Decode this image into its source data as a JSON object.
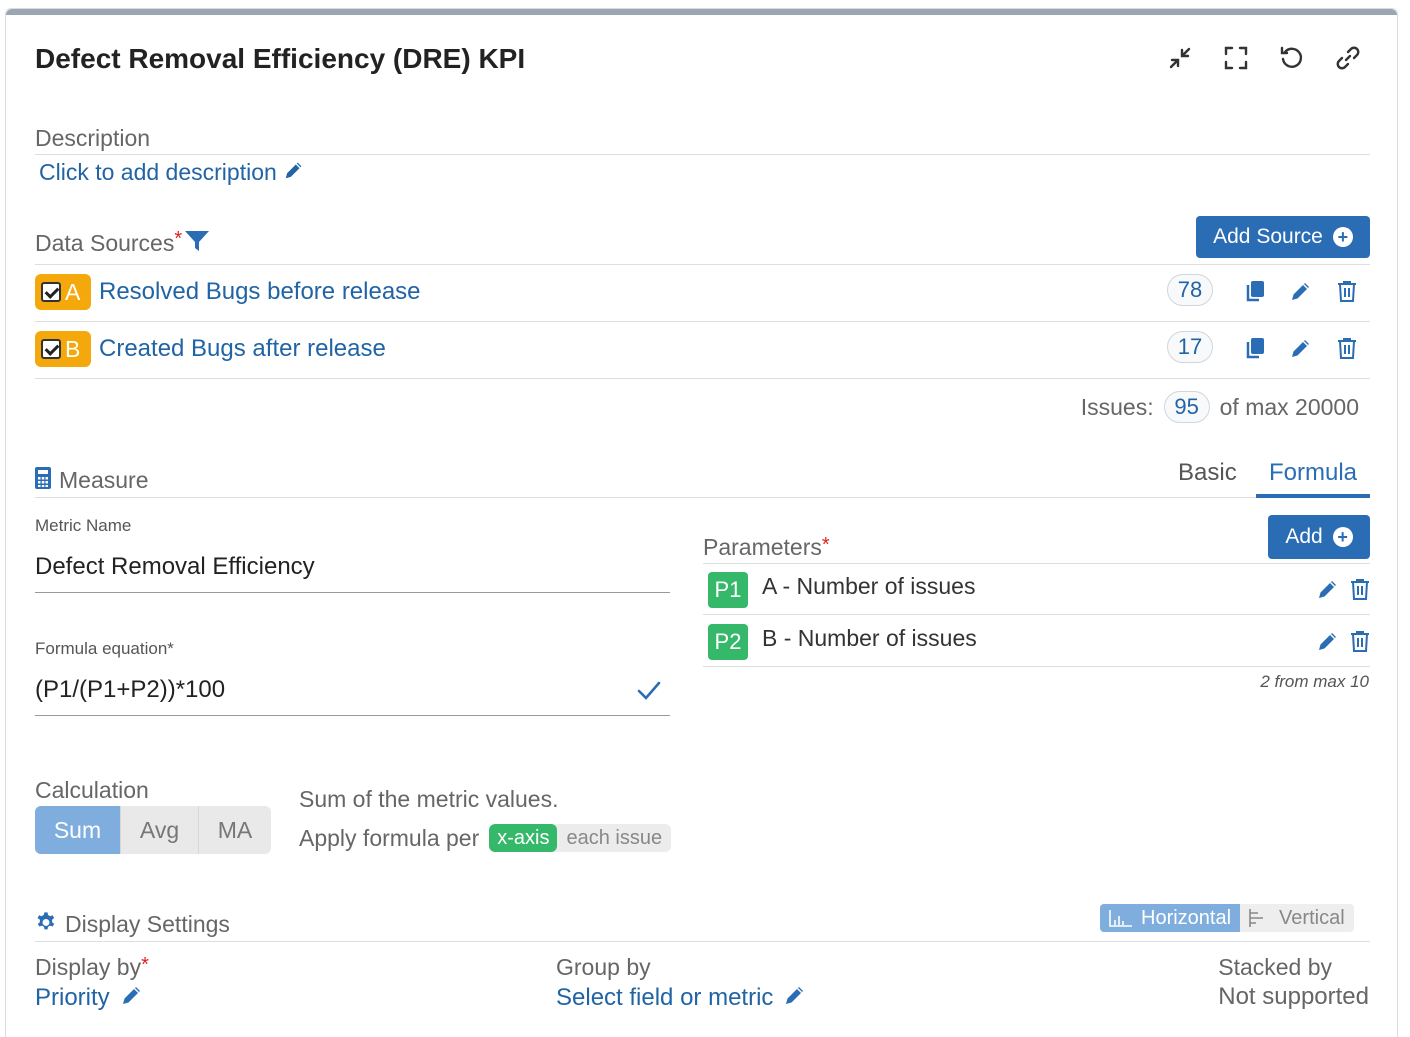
{
  "header": {
    "title": "Defect Removal Efficiency (DRE) KPI",
    "icons": [
      "collapse-arrows-icon",
      "fullscreen-icon",
      "reset-icon",
      "link-icon"
    ]
  },
  "description": {
    "label": "Description",
    "add_link": "Click to add description"
  },
  "data_sources": {
    "label": "Data Sources",
    "required_mark": "*",
    "add_button": "Add Source",
    "items": [
      {
        "letter": "A",
        "name": "Resolved Bugs before release",
        "count": "78"
      },
      {
        "letter": "B",
        "name": "Created Bugs after release",
        "count": "17"
      }
    ],
    "issues_label": "Issues:",
    "issues_total": "95",
    "issues_max": "of max 20000"
  },
  "measure": {
    "label": "Measure",
    "tabs": [
      {
        "label": "Basic",
        "active": false
      },
      {
        "label": "Formula",
        "active": true
      }
    ],
    "metric_name_label": "Metric Name",
    "metric_name_value": "Defect Removal Efficiency",
    "formula_label": "Formula equation*",
    "formula_value": "(P1/(P1+P2))*100",
    "parameters_label": "Parameters",
    "parameters_required": "*",
    "add_button": "Add",
    "parameters": [
      {
        "id": "P1",
        "text": "A - Number of issues"
      },
      {
        "id": "P2",
        "text": "B - Number of issues"
      }
    ],
    "parameters_limit": "2 from max 10"
  },
  "calculation": {
    "label": "Calculation",
    "options": [
      {
        "label": "Sum",
        "active": true
      },
      {
        "label": "Avg",
        "active": false
      },
      {
        "label": "MA",
        "active": false
      }
    ],
    "description": "Sum of the metric values.",
    "apply_label": "Apply formula per",
    "apply_options": [
      {
        "label": "x-axis",
        "active": true
      },
      {
        "label": "each issue",
        "active": false
      }
    ]
  },
  "display": {
    "label": "Display Settings",
    "orientation": [
      {
        "label": "Horizontal",
        "active": true
      },
      {
        "label": "Vertical",
        "active": false
      }
    ],
    "display_by_label": "Display by",
    "display_by_required": "*",
    "display_by_value": "Priority",
    "group_by_label": "Group by",
    "group_by_value": "Select field or metric",
    "stacked_by_label": "Stacked by",
    "stacked_by_value": "Not supported"
  },
  "colors": {
    "accent": "#2a6db4",
    "link": "#2164a5",
    "source_badge": "#f5a80b",
    "param_badge": "#35b86a",
    "required": "#e02020"
  }
}
